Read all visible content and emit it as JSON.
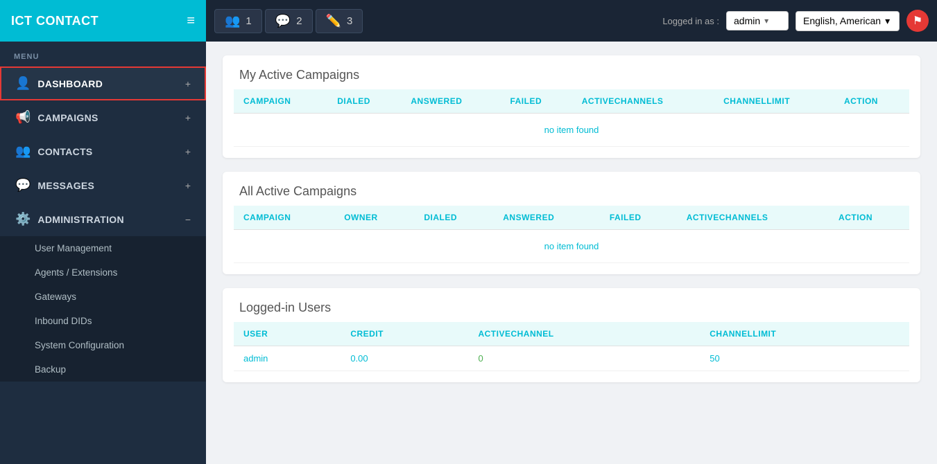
{
  "brand": {
    "name": "ICT CONTACT"
  },
  "topbar": {
    "tabs": [
      {
        "icon": "👥",
        "count": "1"
      },
      {
        "icon": "💬",
        "count": "2"
      },
      {
        "icon": "✏️",
        "count": "3"
      }
    ],
    "logged_in_label": "Logged in as :",
    "user": "admin",
    "language": "English, American"
  },
  "sidebar": {
    "menu_label": "MENU",
    "items": [
      {
        "id": "dashboard",
        "icon": "👤",
        "label": "DASHBOARD",
        "suffix": "+",
        "active": true
      },
      {
        "id": "campaigns",
        "icon": "📢",
        "label": "CAMPAIGNS",
        "suffix": "+"
      },
      {
        "id": "contacts",
        "icon": "👥",
        "label": "CONTACTS",
        "suffix": "+"
      },
      {
        "id": "messages",
        "icon": "💬",
        "label": "MESSAGES",
        "suffix": "+"
      },
      {
        "id": "administration",
        "icon": "⚙️",
        "label": "ADMINISTRATION",
        "suffix": "−"
      }
    ],
    "submenu": [
      "User Management",
      "Agents / Extensions",
      "Gateways",
      "Inbound DIDs",
      "System Configuration",
      "Backup"
    ]
  },
  "my_active_campaigns": {
    "title": "My Active Campaigns",
    "columns": [
      "CAMPAIGN",
      "DIALED",
      "ANSWERED",
      "FAILED",
      "ACTIVECHANNELS",
      "CHANNELLIMIT",
      "ACTION"
    ],
    "no_item_text": "no item found"
  },
  "all_active_campaigns": {
    "title": "All Active Campaigns",
    "columns": [
      "CAMPAIGN",
      "OWNER",
      "DIALED",
      "ANSWERED",
      "FAILED",
      "ACTIVECHANNELS",
      "ACTION"
    ],
    "no_item_text": "no item found"
  },
  "logged_in_users": {
    "title": "Logged-in Users",
    "columns": [
      "USER",
      "CREDIT",
      "ACTIVECHANNEL",
      "CHANNELLIMIT"
    ],
    "rows": [
      {
        "user": "admin",
        "credit": "0.00",
        "activechannel": "0",
        "channellimit": "50"
      }
    ]
  },
  "icons": {
    "hamburger": "≡",
    "chevron_down": "▾",
    "flag": "⚑"
  }
}
